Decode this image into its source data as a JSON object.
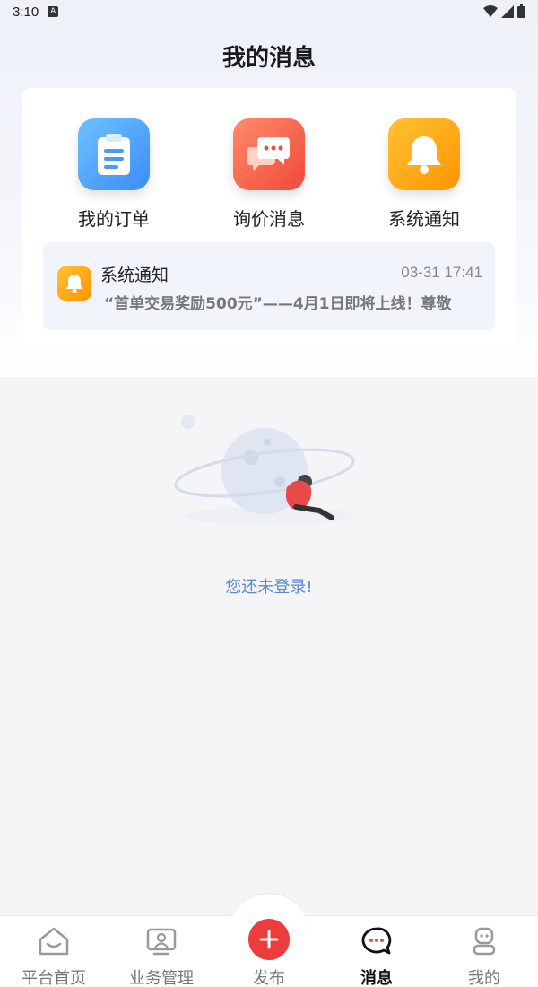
{
  "status_bar": {
    "time": "3:10",
    "indicator": "A"
  },
  "header": {
    "title": "我的消息"
  },
  "categories": [
    {
      "label": "我的订单",
      "icon": "clipboard-icon",
      "color": "#3b8cf5"
    },
    {
      "label": "询价消息",
      "icon": "chat-bubbles-icon",
      "color": "#f04a3a"
    },
    {
      "label": "系统通知",
      "icon": "bell-icon",
      "color": "#ff9500"
    }
  ],
  "notice": {
    "title": "系统通知",
    "time": "03-31 17:41",
    "preview": "“首单交易奖励500元”——4月1日即将上线！尊敬"
  },
  "empty_state": {
    "text": "您还未登录!"
  },
  "tabbar": {
    "home": "平台首页",
    "business": "业务管理",
    "publish": "发布",
    "messages": "消息",
    "mine": "我的"
  },
  "colors": {
    "accent": "#ee3b3b",
    "link": "#5a8ad0"
  }
}
